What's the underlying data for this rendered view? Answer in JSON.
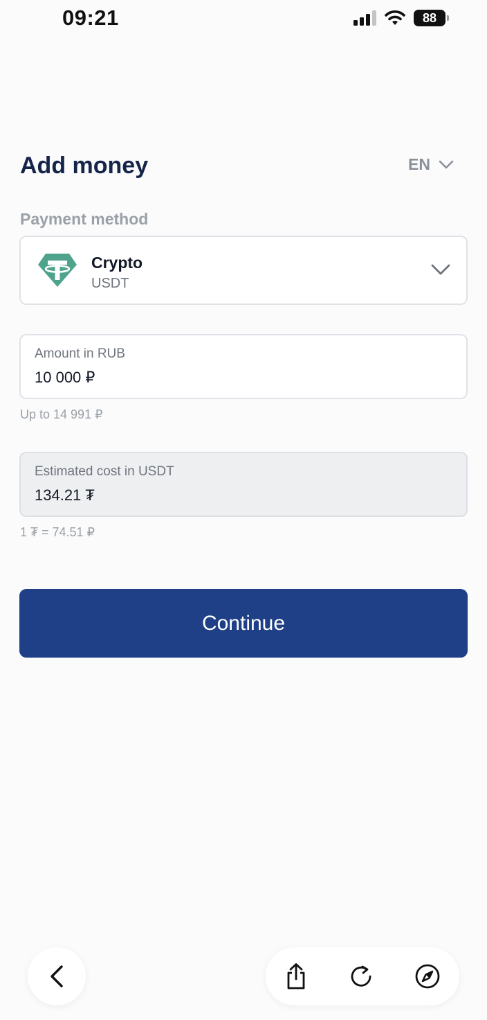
{
  "status_bar": {
    "time": "09:21",
    "battery": "88"
  },
  "header": {
    "title": "Add money",
    "language": "EN"
  },
  "payment_method": {
    "label": "Payment method",
    "selected_name": "Crypto",
    "selected_sub": "USDT",
    "logo_color": "#4fa38c"
  },
  "amount": {
    "label": "Amount in RUB",
    "value": "10 000 ₽",
    "hint": "Up to 14 991 ₽"
  },
  "estimate": {
    "label": "Estimated cost in USDT",
    "value": "134.21 ₮",
    "rate": "1 ₮ = 74.51 ₽"
  },
  "continue_label": "Continue",
  "colors": {
    "primary": "#1f3f86",
    "title": "#15254a",
    "muted": "#9aa0a8"
  },
  "toolbar": {
    "icons": [
      "back-icon",
      "share-icon",
      "reload-icon",
      "compass-icon"
    ]
  }
}
